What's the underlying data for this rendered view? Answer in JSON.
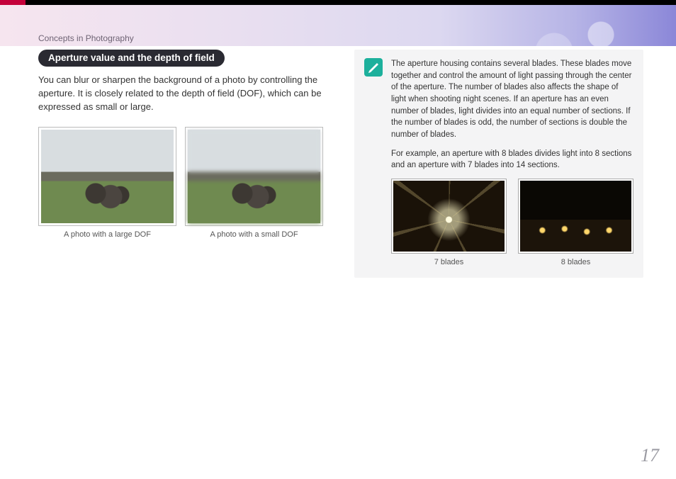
{
  "breadcrumb": "Concepts in Photography",
  "section_heading": "Aperture value and the depth of field",
  "intro_text": "You can blur or sharpen the background of a photo by controlling the aperture. It is closely related to the depth of field (DOF), which can be expressed as small or large.",
  "dof_examples": {
    "large_caption": "A photo with a large DOF",
    "small_caption": "A photo with a small DOF"
  },
  "note": {
    "paragraph1": "The aperture housing contains several blades. These blades move together and control the amount of light passing through the center of the aperture. The number of blades also affects the shape of light when shooting night scenes. If an aperture has an even number of blades, light divides into an equal number of sections. If the number of blades is odd, the number of sections is double the number of blades.",
    "paragraph2": "For example, an aperture with 8 blades divides light into 8 sections and an aperture with 7 blades into 14 sections.",
    "blade7_caption": "7 blades",
    "blade8_caption": "8 blades"
  },
  "page_number": "17"
}
